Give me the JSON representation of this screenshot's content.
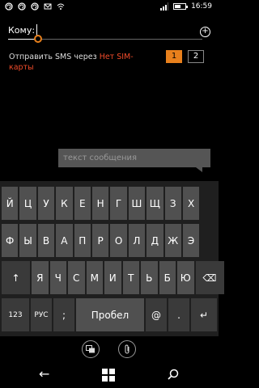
{
  "status": {
    "time": "16:59",
    "battery_level": 0.55,
    "left_icons": [
      "notification-icon",
      "notification-icon",
      "notification-icon",
      "message-icon",
      "wifi-icon"
    ],
    "right_icons": [
      "signal-icon",
      "battery-icon"
    ]
  },
  "compose": {
    "to_label": "Кому:",
    "sms_via_prefix": "Отправить SMS через ",
    "sms_via_sim": "Нет SIM-карты",
    "sim_options": [
      "1",
      "2"
    ],
    "accent_color": "#e8801c",
    "warning_color": "#f04b2a",
    "message_placeholder": "текст сообщения"
  },
  "keyboard": {
    "row1": [
      "Й",
      "Ц",
      "У",
      "К",
      "Е",
      "Н",
      "Г",
      "Ш",
      "Щ",
      "З",
      "Х"
    ],
    "row2": [
      "Ф",
      "Ы",
      "В",
      "А",
      "П",
      "Р",
      "О",
      "Л",
      "Д",
      "Ж",
      "Э"
    ],
    "row3": [
      "Я",
      "Ч",
      "С",
      "М",
      "И",
      "Т",
      "Ь",
      "Б",
      "Ю"
    ],
    "num_label": "123",
    "lang_label": "РУС",
    "semicolon_label": ";",
    "space_label": "Пробел",
    "at_label": "@",
    "dot_label": ".",
    "shift_icon": "↑",
    "backspace_icon": "⌫",
    "enter_icon": "↵"
  },
  "tools": {
    "sim_icon": "sim-icon",
    "attach_icon": "attach-icon"
  },
  "nav": {
    "back_icon": "←",
    "start_icon": "windows-icon",
    "search_icon": "search-icon"
  }
}
